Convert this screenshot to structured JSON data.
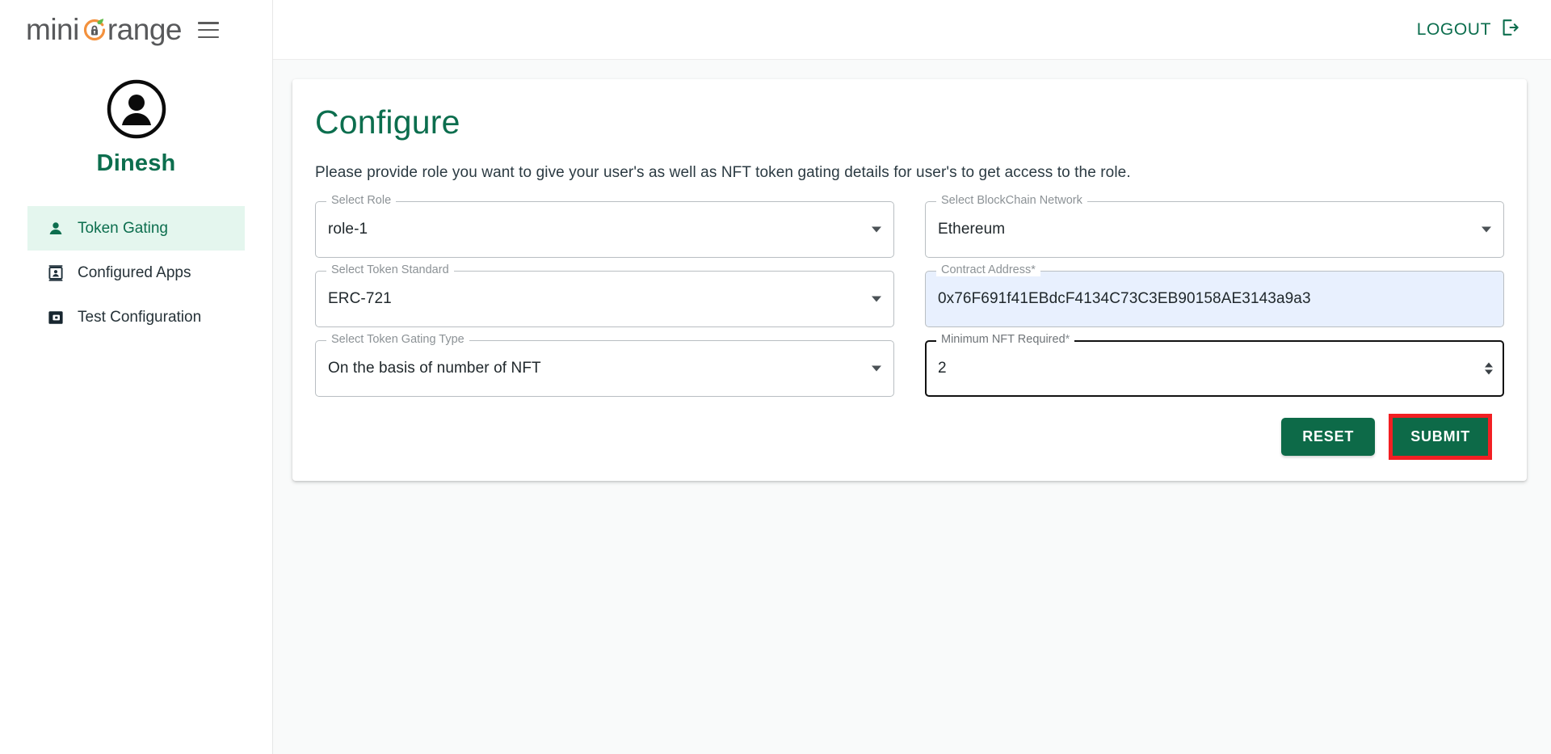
{
  "brand": {
    "logo_mini": "mini",
    "logo_range": "range",
    "logo_icon": "orange-lock-icon",
    "menu_icon": "hamburger-menu-icon"
  },
  "sidebar": {
    "profile": {
      "avatar_icon": "user-avatar-icon",
      "name": "Dinesh"
    },
    "items": [
      {
        "label": "Token Gating",
        "icon": "person-icon",
        "active": true
      },
      {
        "label": "Configured Apps",
        "icon": "id-badge-icon",
        "active": false
      },
      {
        "label": "Test Configuration",
        "icon": "app-window-icon",
        "active": false
      }
    ]
  },
  "topbar": {
    "logout_label": "LOGOUT",
    "logout_icon": "logout-arrow-icon"
  },
  "main": {
    "title": "Configure",
    "description": "Please provide role you want to give your user's as well as NFT token gating details for user's to get access to the role.",
    "fields": [
      {
        "name": "select-role",
        "label": "Select Role",
        "value": "role-1",
        "required": false,
        "control": "select"
      },
      {
        "name": "select-blockchain-network",
        "label": "Select BlockChain Network",
        "value": "Ethereum",
        "required": false,
        "control": "select"
      },
      {
        "name": "select-token-standard",
        "label": "Select Token Standard",
        "value": "ERC-721",
        "required": false,
        "control": "select"
      },
      {
        "name": "contract-address",
        "label": "Contract Address",
        "value": "0x76F691f41EBdcF4134C73C3EB90158AE3143a9a3",
        "required": true,
        "control": "text"
      },
      {
        "name": "select-token-gating-type",
        "label": "Select Token Gating Type",
        "value": "On the basis of number of NFT",
        "required": false,
        "control": "select"
      },
      {
        "name": "minimum-nft-required",
        "label": "Minimum NFT Required",
        "value": "2",
        "required": true,
        "control": "number"
      }
    ],
    "buttons": {
      "reset": "RESET",
      "submit": "SUBMIT"
    }
  },
  "colors": {
    "brand_green": "#0c6e4e",
    "button_green": "#0d6a48",
    "active_nav_bg": "#e4f6ee",
    "highlight_red": "#f21f23",
    "autofill_blue": "#e8f0fe",
    "logo_orange": "#f3913d"
  }
}
